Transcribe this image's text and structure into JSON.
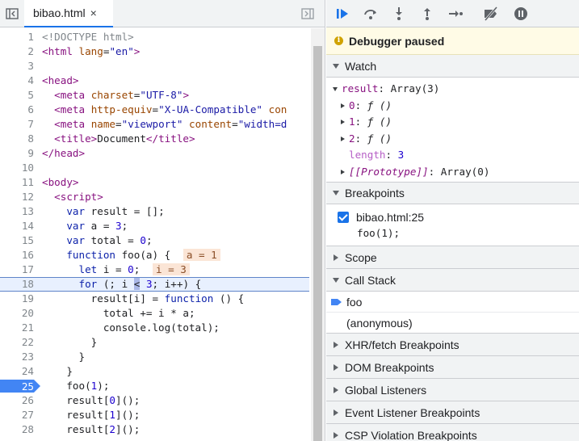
{
  "tab": {
    "filename": "bibao.html",
    "close": "×"
  },
  "code": {
    "lines": [
      {
        "n": "1",
        "html": "<span class=\"t-cmt\">&lt;!DOCTYPE html&gt;</span>"
      },
      {
        "n": "2",
        "html": "<span class=\"t-tag\">&lt;html</span> <span class=\"t-attr\">lang</span>=<span class=\"t-val\">\"en\"</span><span class=\"t-tag\">&gt;</span>"
      },
      {
        "n": "3",
        "html": ""
      },
      {
        "n": "4",
        "html": "<span class=\"t-tag\">&lt;head&gt;</span>"
      },
      {
        "n": "5",
        "html": "  <span class=\"t-tag\">&lt;meta</span> <span class=\"t-attr\">charset</span>=<span class=\"t-val\">\"UTF-8\"</span><span class=\"t-tag\">&gt;</span>"
      },
      {
        "n": "6",
        "html": "  <span class=\"t-tag\">&lt;meta</span> <span class=\"t-attr\">http-equiv</span>=<span class=\"t-val\">\"X-UA-Compatible\"</span> <span class=\"t-attr\">con</span>"
      },
      {
        "n": "7",
        "html": "  <span class=\"t-tag\">&lt;meta</span> <span class=\"t-attr\">name</span>=<span class=\"t-val\">\"viewport\"</span> <span class=\"t-attr\">content</span>=<span class=\"t-val\">\"width=d</span>"
      },
      {
        "n": "8",
        "html": "  <span class=\"t-tag\">&lt;title&gt;</span>Document<span class=\"t-tag\">&lt;/title&gt;</span>"
      },
      {
        "n": "9",
        "html": "<span class=\"t-tag\">&lt;/head&gt;</span>"
      },
      {
        "n": "10",
        "html": ""
      },
      {
        "n": "11",
        "html": "<span class=\"t-tag\">&lt;body&gt;</span>"
      },
      {
        "n": "12",
        "html": "  <span class=\"t-tag\">&lt;script&gt;</span>"
      },
      {
        "n": "13",
        "html": "    <span class=\"t-kw\">var</span> result = [];"
      },
      {
        "n": "14",
        "html": "    <span class=\"t-kw\">var</span> a = <span class=\"t-num\">3</span>;"
      },
      {
        "n": "15",
        "html": "    <span class=\"t-kw\">var</span> total = <span class=\"t-num\">0</span>;"
      },
      {
        "n": "16",
        "html": "    <span class=\"t-kw\">function</span> foo(a) { <span class=\"inline-val\">a = 1</span>"
      },
      {
        "n": "17",
        "html": "      <span class=\"t-kw\">let</span> i = <span class=\"t-num\">0</span>; <span class=\"inline-val\">i = 3</span>"
      },
      {
        "n": "18",
        "html": "      <span class=\"t-kw\">for</span> (; i <span class=\"caret-hl\">&lt;</span> <span class=\"t-num\">3</span>; i++) {"
      },
      {
        "n": "19",
        "html": "        result[i] = <span class=\"t-kw\">function</span> () {"
      },
      {
        "n": "20",
        "html": "          total += i * a;"
      },
      {
        "n": "21",
        "html": "          console.log(total);"
      },
      {
        "n": "22",
        "html": "        }"
      },
      {
        "n": "23",
        "html": "      }"
      },
      {
        "n": "24",
        "html": "    }"
      },
      {
        "n": "25",
        "html": "    foo(<span class=\"t-num\">1</span>);"
      },
      {
        "n": "26",
        "html": "    result[<span class=\"t-num\">0</span>]();"
      },
      {
        "n": "27",
        "html": "    result[<span class=\"t-num\">1</span>]();"
      },
      {
        "n": "28",
        "html": "    result[<span class=\"t-num\">2</span>]();"
      }
    ],
    "execution_line": "18",
    "breakpoint_line": "25"
  },
  "debugger": {
    "paused_message": "Debugger paused",
    "watch": {
      "title": "Watch",
      "root_key": "result",
      "root_value": "Array(3)",
      "items": [
        {
          "key": "0",
          "value": "ƒ ()"
        },
        {
          "key": "1",
          "value": "ƒ ()"
        },
        {
          "key": "2",
          "value": "ƒ ()"
        }
      ],
      "length_key": "length",
      "length_value": "3",
      "proto_key": "[[Prototype]]",
      "proto_value": "Array(0)"
    },
    "breakpoints": {
      "title": "Breakpoints",
      "file": "bibao.html:25",
      "code": "foo(1);"
    },
    "scope_title": "Scope",
    "call_stack": {
      "title": "Call Stack",
      "frames": [
        "foo",
        "(anonymous)"
      ]
    },
    "collapsed_sections": [
      "XHR/fetch Breakpoints",
      "DOM Breakpoints",
      "Global Listeners",
      "Event Listener Breakpoints",
      "CSP Violation Breakpoints"
    ]
  },
  "colors": {
    "accent": "#1a73e8",
    "breakpoint": "#4285f4",
    "paused_banner": "#fffbe6"
  },
  "icons": [
    "navigator-toggle-icon",
    "debugger-toggle-icon",
    "resume-icon",
    "step-over-icon",
    "step-into-icon",
    "step-out-icon",
    "step-icon",
    "deactivate-breakpoints-icon",
    "pause-on-exceptions-icon",
    "info-icon",
    "execution-arrow-icon"
  ]
}
